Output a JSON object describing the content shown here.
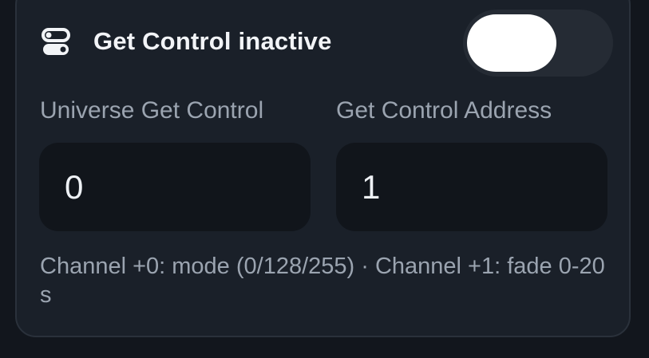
{
  "colors": {
    "background": "#12161d",
    "card": "#1a2029",
    "card_border": "#2a313b",
    "input_background": "#11151b",
    "title_text": "#f2f4f7",
    "muted_text": "#9ba4b0",
    "switch_track": "#252b34",
    "switch_knob": "#ffffff"
  },
  "get_control": {
    "icon": "toggle-icon",
    "title": "Get Control inactive",
    "enabled": false
  },
  "fields": {
    "universe": {
      "label": "Universe Get Control",
      "value": "0"
    },
    "address": {
      "label": "Get Control Address",
      "value": "1"
    }
  },
  "hint": "Channel +0: mode (0/128/255) · Channel +1: fade 0-20 s"
}
